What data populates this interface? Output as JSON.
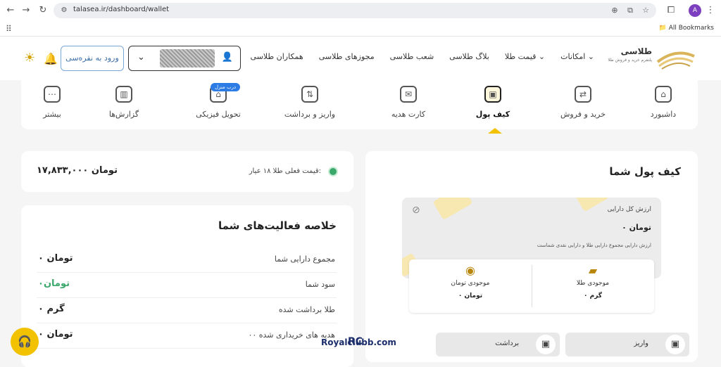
{
  "browser": {
    "url": "talasea.ir/dashboard/wallet",
    "all_bookmarks": "All Bookmarks",
    "profile_initial": "A"
  },
  "header": {
    "brand_name": "طلاسی",
    "brand_sub": "پلتفرم خرید و فروش طلا",
    "menu": [
      "امکانات",
      "قیمت طلا",
      "بلاگ طلاسی",
      "شعب طلاسی",
      "مجوزهای طلاسی",
      "همکاران طلاسی"
    ],
    "login_label": "ورود به نقره‌سی"
  },
  "tabs": [
    {
      "label": "داشبورد",
      "icon": "home-icon"
    },
    {
      "label": "خرید و فروش",
      "icon": "exchange-icon"
    },
    {
      "label": "کیف پول",
      "icon": "wallet-icon",
      "active": true
    },
    {
      "label": "کارت هدیه",
      "icon": "gift-card-icon"
    },
    {
      "label": "واریز و برداشت",
      "icon": "deposit-icon"
    },
    {
      "label": "تحویل فیزیکی",
      "icon": "store-icon",
      "badge": "درب منزل"
    },
    {
      "label": "گزارش‌ها",
      "icon": "chart-icon"
    },
    {
      "label": "بیشتر",
      "icon": "more-icon"
    }
  ],
  "price": {
    "label": "قیمت فعلی طلا ۱۸ عیار:",
    "value": "۱۷,۸۳۳,۰۰۰ تومان"
  },
  "summary": {
    "title": "خلاصه فعالیت‌های شما",
    "rows": [
      {
        "label": "مجموع دارایی شما",
        "value": "۰ تومان"
      },
      {
        "label": "سود شما",
        "value": "۰تومان"
      },
      {
        "label": "طلا برداشت شده",
        "value": "۰ گرم"
      },
      {
        "label": "۰۰ هدیه های خریداری شده",
        "value": "۰ تومان"
      }
    ]
  },
  "wallet": {
    "title": "کیف پول شما",
    "total_label": "ارزش کل دارایی",
    "total_value": "۰ تومان",
    "total_note": "ارزش دارایی مجموع دارایی طلا و دارایی نقدی شماست",
    "gold_label": "موجودی طلا",
    "gold_value": "۰ گرم",
    "toman_label": "موجودی تومان",
    "toman_value": "۰ تومان",
    "deposit_label": "واریز",
    "withdraw_label": "برداشت"
  },
  "watermark": {
    "rc": "RC",
    "text": "Royalclubb.com"
  }
}
